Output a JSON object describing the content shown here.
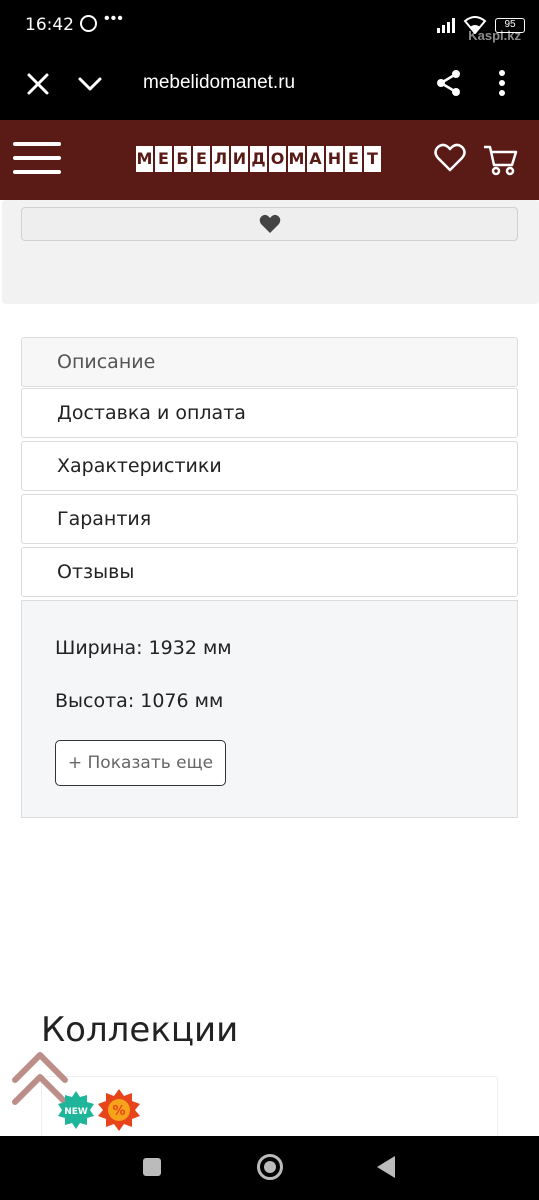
{
  "status_bar": {
    "time": "16:42",
    "dots": "•••",
    "battery": "95",
    "watermark": "Kaspi.kz"
  },
  "browser": {
    "url": "mebelidomanet.ru"
  },
  "site": {
    "logo_letters": [
      "М",
      "Е",
      "Б",
      "Е",
      "Л",
      "И",
      "Д",
      "О",
      "М",
      "А",
      "Н",
      "Е",
      "Т"
    ],
    "header_color": "#5a1a15"
  },
  "tabs": [
    {
      "label": "Описание",
      "active": true
    },
    {
      "label": "Доставка и оплата",
      "active": false
    },
    {
      "label": "Характеристики",
      "active": false
    },
    {
      "label": "Гарантия",
      "active": false
    },
    {
      "label": "Отзывы",
      "active": false
    }
  ],
  "specs": {
    "width": "Ширина: 1932 мм",
    "height": "Высота: 1076 мм"
  },
  "show_more_label": "+ Показать еще",
  "collections_title": "Коллекции",
  "badges": {
    "new": "NEW",
    "percent": "%"
  },
  "icons": [
    "whatsapp-icon",
    "close-icon",
    "chevron-down-icon",
    "share-icon",
    "more-vert-icon",
    "menu-icon",
    "heart-icon",
    "cart-icon",
    "scroll-up-icon"
  ]
}
